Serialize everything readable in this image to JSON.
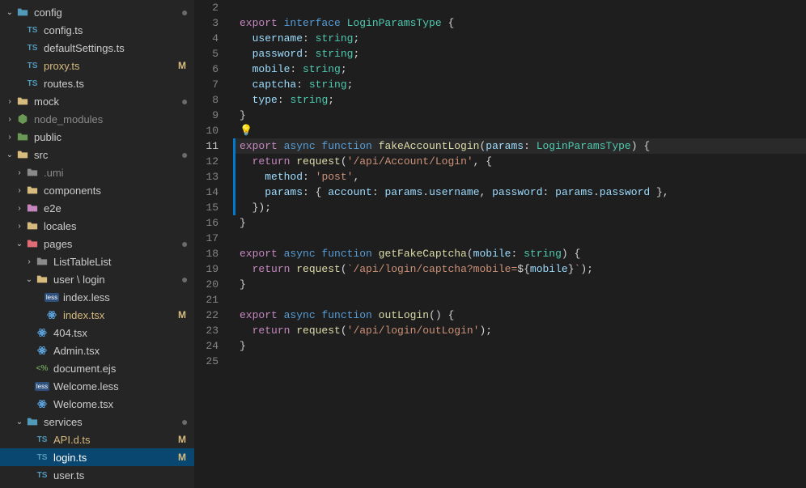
{
  "sidebar": {
    "items": [
      {
        "indent": 0,
        "chev": "down",
        "icon": "folder",
        "iconClass": "c-teal",
        "label": "config",
        "dot": true
      },
      {
        "indent": 1,
        "chev": "none",
        "icon": "ts",
        "iconClass": "c-teal",
        "label": "config.ts"
      },
      {
        "indent": 1,
        "chev": "none",
        "icon": "ts",
        "iconClass": "c-teal",
        "label": "defaultSettings.ts"
      },
      {
        "indent": 1,
        "chev": "none",
        "icon": "ts",
        "iconClass": "c-teal",
        "label": "proxy.ts",
        "git": "M",
        "gitColor": true
      },
      {
        "indent": 1,
        "chev": "none",
        "icon": "ts",
        "iconClass": "c-teal",
        "label": "routes.ts"
      },
      {
        "indent": 0,
        "chev": "right",
        "icon": "folder",
        "iconClass": "c-yellow",
        "label": "mock",
        "dot": true
      },
      {
        "indent": 0,
        "chev": "right",
        "icon": "nodemod",
        "iconClass": "c-green",
        "label": "node_modules",
        "dim": true
      },
      {
        "indent": 0,
        "chev": "right",
        "icon": "folder",
        "iconClass": "c-green",
        "label": "public"
      },
      {
        "indent": 0,
        "chev": "down",
        "icon": "folder",
        "iconClass": "c-yellow",
        "label": "src",
        "dot": true
      },
      {
        "indent": 1,
        "chev": "right",
        "icon": "folder",
        "iconClass": "c-grey",
        "label": ".umi",
        "dim": true
      },
      {
        "indent": 1,
        "chev": "right",
        "icon": "folder",
        "iconClass": "c-yellow",
        "label": "components"
      },
      {
        "indent": 1,
        "chev": "right",
        "icon": "folder",
        "iconClass": "c-pink",
        "label": "e2e"
      },
      {
        "indent": 1,
        "chev": "right",
        "icon": "folder",
        "iconClass": "c-yellow",
        "label": "locales"
      },
      {
        "indent": 1,
        "chev": "down",
        "icon": "folder",
        "iconClass": "c-red",
        "label": "pages",
        "dot": true
      },
      {
        "indent": 2,
        "chev": "right",
        "icon": "folder",
        "iconClass": "c-grey",
        "label": "ListTableList"
      },
      {
        "indent": 2,
        "chev": "down",
        "icon": "folder",
        "iconClass": "c-yellow",
        "label": "user \\ login",
        "dot": true
      },
      {
        "indent": 3,
        "chev": "none",
        "icon": "less",
        "iconClass": "c-blue",
        "label": "index.less"
      },
      {
        "indent": 3,
        "chev": "none",
        "icon": "react",
        "iconClass": "c-blue",
        "label": "index.tsx",
        "git": "M",
        "gitColor": true
      },
      {
        "indent": 2,
        "chev": "none",
        "icon": "react",
        "iconClass": "c-blue",
        "label": "404.tsx"
      },
      {
        "indent": 2,
        "chev": "none",
        "icon": "react",
        "iconClass": "c-blue",
        "label": "Admin.tsx"
      },
      {
        "indent": 2,
        "chev": "none",
        "icon": "ejs",
        "iconClass": "c-green",
        "label": "document.ejs"
      },
      {
        "indent": 2,
        "chev": "none",
        "icon": "less",
        "iconClass": "c-blue",
        "label": "Welcome.less"
      },
      {
        "indent": 2,
        "chev": "none",
        "icon": "react",
        "iconClass": "c-blue",
        "label": "Welcome.tsx"
      },
      {
        "indent": 1,
        "chev": "down",
        "icon": "folder",
        "iconClass": "c-teal",
        "label": "services",
        "dot": true
      },
      {
        "indent": 2,
        "chev": "none",
        "icon": "ts",
        "iconClass": "c-teal",
        "label": "API.d.ts",
        "git": "M",
        "gitColor": true
      },
      {
        "indent": 2,
        "chev": "none",
        "icon": "ts",
        "iconClass": "c-teal",
        "label": "login.ts",
        "git": "M",
        "active": true
      },
      {
        "indent": 2,
        "chev": "none",
        "icon": "ts",
        "iconClass": "c-teal",
        "label": "user.ts"
      }
    ]
  },
  "editor": {
    "lineStart": 2,
    "lineEnd": 25,
    "currentLine": 11,
    "bulbLine": 10,
    "blueBarLines": [
      11,
      12,
      13,
      14,
      15
    ],
    "code": {
      "2": [
        [
          "",
          "plain"
        ]
      ],
      "3": [
        [
          "export ",
          "kw"
        ],
        [
          "interface ",
          "mod"
        ],
        [
          "LoginParamsType ",
          "type"
        ],
        [
          "{",
          "pun"
        ]
      ],
      "4": [
        [
          "  ",
          "plain"
        ],
        [
          "username",
          "var"
        ],
        [
          ": ",
          "pun"
        ],
        [
          "string",
          "type"
        ],
        [
          ";",
          "pun"
        ]
      ],
      "5": [
        [
          "  ",
          "plain"
        ],
        [
          "password",
          "var"
        ],
        [
          ": ",
          "pun"
        ],
        [
          "string",
          "type"
        ],
        [
          ";",
          "pun"
        ]
      ],
      "6": [
        [
          "  ",
          "plain"
        ],
        [
          "mobile",
          "var"
        ],
        [
          ": ",
          "pun"
        ],
        [
          "string",
          "type"
        ],
        [
          ";",
          "pun"
        ]
      ],
      "7": [
        [
          "  ",
          "plain"
        ],
        [
          "captcha",
          "var"
        ],
        [
          ": ",
          "pun"
        ],
        [
          "string",
          "type"
        ],
        [
          ";",
          "pun"
        ]
      ],
      "8": [
        [
          "  ",
          "plain"
        ],
        [
          "type",
          "var"
        ],
        [
          ": ",
          "pun"
        ],
        [
          "string",
          "type"
        ],
        [
          ";",
          "pun"
        ]
      ],
      "9": [
        [
          "}",
          "pun"
        ]
      ],
      "10": [
        [
          "",
          "plain"
        ]
      ],
      "11": [
        [
          "export ",
          "kw"
        ],
        [
          "async ",
          "mod"
        ],
        [
          "function ",
          "mod"
        ],
        [
          "fakeAccountLogin",
          "fn"
        ],
        [
          "(",
          "pun"
        ],
        [
          "params",
          "var"
        ],
        [
          ": ",
          "pun"
        ],
        [
          "LoginParamsType",
          "type"
        ],
        [
          ") {",
          "pun"
        ]
      ],
      "12": [
        [
          "  ",
          "plain"
        ],
        [
          "return ",
          "kw"
        ],
        [
          "request",
          "fn"
        ],
        [
          "(",
          "pun"
        ],
        [
          "'/api/Account/Login'",
          "str"
        ],
        [
          ", {",
          "pun"
        ]
      ],
      "13": [
        [
          "    ",
          "plain"
        ],
        [
          "method",
          "var"
        ],
        [
          ": ",
          "pun"
        ],
        [
          "'post'",
          "str"
        ],
        [
          ",",
          "pun"
        ]
      ],
      "14": [
        [
          "    ",
          "plain"
        ],
        [
          "params",
          "var"
        ],
        [
          ": { ",
          "pun"
        ],
        [
          "account",
          "var"
        ],
        [
          ": ",
          "pun"
        ],
        [
          "params",
          "var"
        ],
        [
          ".",
          "pun"
        ],
        [
          "username",
          "var"
        ],
        [
          ", ",
          "pun"
        ],
        [
          "password",
          "var"
        ],
        [
          ": ",
          "pun"
        ],
        [
          "params",
          "var"
        ],
        [
          ".",
          "pun"
        ],
        [
          "password",
          "var"
        ],
        [
          " },",
          "pun"
        ]
      ],
      "15": [
        [
          "  });",
          "pun"
        ]
      ],
      "16": [
        [
          "}",
          "pun"
        ]
      ],
      "17": [
        [
          "",
          "plain"
        ]
      ],
      "18": [
        [
          "export ",
          "kw"
        ],
        [
          "async ",
          "mod"
        ],
        [
          "function ",
          "mod"
        ],
        [
          "getFakeCaptcha",
          "fn"
        ],
        [
          "(",
          "pun"
        ],
        [
          "mobile",
          "var"
        ],
        [
          ": ",
          "pun"
        ],
        [
          "string",
          "type"
        ],
        [
          ") {",
          "pun"
        ]
      ],
      "19": [
        [
          "  ",
          "plain"
        ],
        [
          "return ",
          "kw"
        ],
        [
          "request",
          "fn"
        ],
        [
          "(",
          "pun"
        ],
        [
          "`/api/login/captcha?mobile=",
          "str"
        ],
        [
          "${",
          "pun"
        ],
        [
          "mobile",
          "var"
        ],
        [
          "}",
          "pun"
        ],
        [
          "`",
          "str"
        ],
        [
          ");",
          "pun"
        ]
      ],
      "20": [
        [
          "}",
          "pun"
        ]
      ],
      "21": [
        [
          "",
          "plain"
        ]
      ],
      "22": [
        [
          "export ",
          "kw"
        ],
        [
          "async ",
          "mod"
        ],
        [
          "function ",
          "mod"
        ],
        [
          "outLogin",
          "fn"
        ],
        [
          "() {",
          "pun"
        ]
      ],
      "23": [
        [
          "  ",
          "plain"
        ],
        [
          "return ",
          "kw"
        ],
        [
          "request",
          "fn"
        ],
        [
          "(",
          "pun"
        ],
        [
          "'/api/login/outLogin'",
          "str"
        ],
        [
          ");",
          "pun"
        ]
      ],
      "24": [
        [
          "}",
          "pun"
        ]
      ],
      "25": [
        [
          "",
          "plain"
        ]
      ]
    }
  }
}
